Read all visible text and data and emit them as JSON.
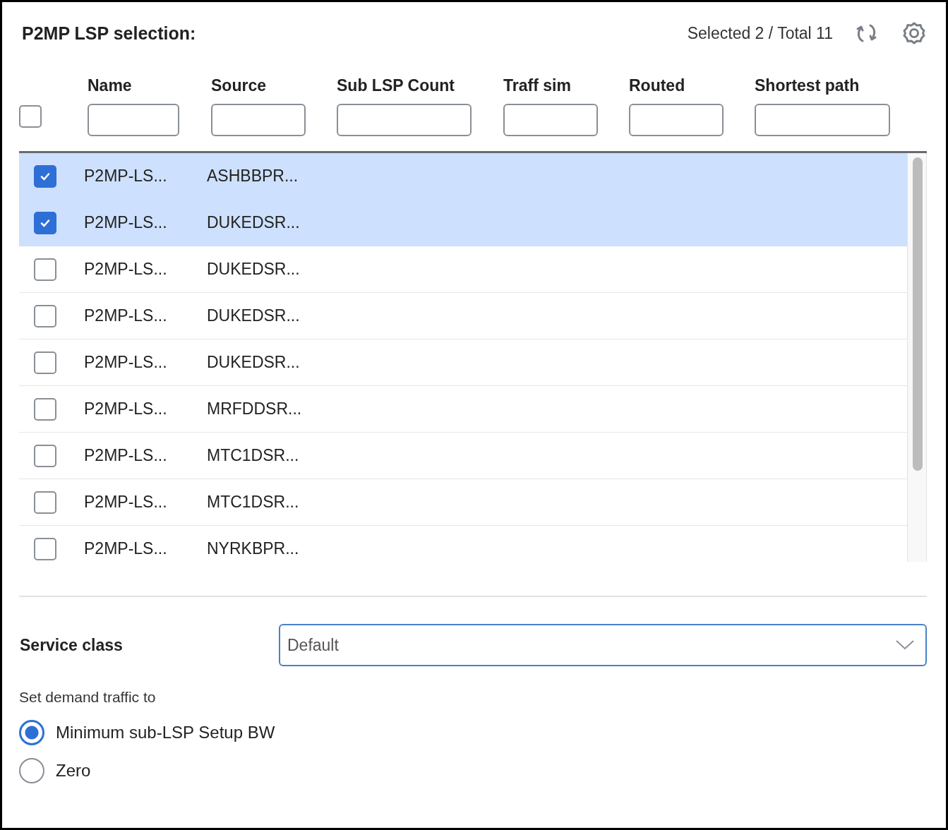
{
  "panel": {
    "title": "P2MP LSP selection:",
    "summary": "Selected 2 / Total 11"
  },
  "table": {
    "select_all": {
      "checked": false
    },
    "columns": [
      {
        "label": "Name"
      },
      {
        "label": "Source"
      },
      {
        "label": "Sub LSP Count"
      },
      {
        "label": "Traff sim"
      },
      {
        "label": "Routed"
      },
      {
        "label": "Shortest path"
      }
    ],
    "rows": [
      {
        "name": "P2MP-LS...",
        "source": "ASHBBPR...",
        "selected": true
      },
      {
        "name": "P2MP-LS...",
        "source": "DUKEDSR...",
        "selected": true
      },
      {
        "name": "P2MP-LS...",
        "source": "DUKEDSR...",
        "selected": false
      },
      {
        "name": "P2MP-LS...",
        "source": "DUKEDSR...",
        "selected": false
      },
      {
        "name": "P2MP-LS...",
        "source": "DUKEDSR...",
        "selected": false
      },
      {
        "name": "P2MP-LS...",
        "source": "MRFDDSR...",
        "selected": false
      },
      {
        "name": "P2MP-LS...",
        "source": "MTC1DSR...",
        "selected": false
      },
      {
        "name": "P2MP-LS...",
        "source": "MTC1DSR...",
        "selected": false
      },
      {
        "name": "P2MP-LS...",
        "source": "NYRKBPR...",
        "selected": false
      }
    ]
  },
  "service_class": {
    "label": "Service class",
    "value": "Default"
  },
  "demand_traffic": {
    "label": "Set demand traffic to",
    "options": [
      {
        "label": "Minimum sub-LSP Setup BW",
        "selected": true
      },
      {
        "label": "Zero",
        "selected": false
      }
    ]
  }
}
